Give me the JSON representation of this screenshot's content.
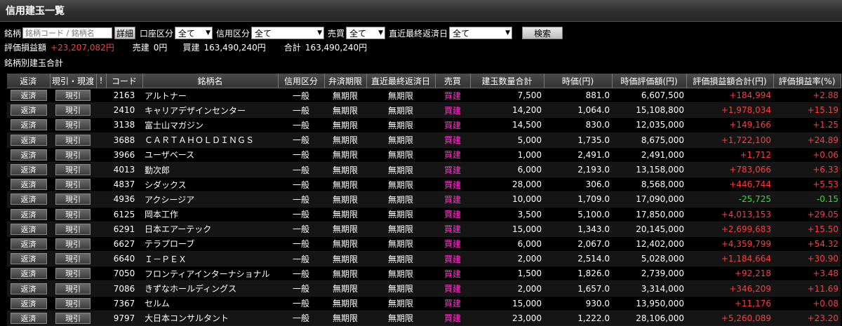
{
  "title": "信用建玉一覧",
  "filters": {
    "meigara_label": "銘柄",
    "meigara_placeholder": "銘柄コード / 銘柄名",
    "detail_button": "詳細",
    "kouza_label": "口座区分",
    "kouza_value": "全て",
    "shinyou_label": "信用区分",
    "shinyou_value": "全て",
    "baibai_label": "売買",
    "baibai_value": "全て",
    "hensai_label": "直近最終返済日",
    "hensai_value": "全て",
    "search_button": "検索"
  },
  "summary": {
    "hyouka_label": "評価損益額",
    "hyouka_value": "+23,207,082円",
    "uri_label": "売建",
    "uri_value": "0円",
    "kai_label": "買建",
    "kai_value": "163,490,240円",
    "total_label": "合計",
    "total_value": "163,490,240円"
  },
  "subheading": "銘柄別建玉合計",
  "columns": [
    "返済",
    "現引・現渡",
    "!",
    "コード",
    "銘柄名",
    "信用区分",
    "弁済期限",
    "直近最終返済日",
    "売買",
    "建玉数量合計",
    "時価(円)",
    "時価評価額(円)",
    "評価損益額合計(円)",
    "評価損益率(%)"
  ],
  "row_buttons": {
    "hensai": "返済",
    "genbiki": "現引"
  },
  "rows": [
    {
      "code": "2163",
      "name": "アルトナー",
      "kubun": "一般",
      "kigen": "無期限",
      "saishu": "無期限",
      "baibai": "買建",
      "qty": "7,500",
      "price": "881.0",
      "value": "6,607,500",
      "pl": "+184,994",
      "rate": "+2.88"
    },
    {
      "code": "2410",
      "name": "キャリアデザインセンター",
      "kubun": "一般",
      "kigen": "無期限",
      "saishu": "無期限",
      "baibai": "買建",
      "qty": "14,200",
      "price": "1,064.0",
      "value": "15,108,800",
      "pl": "+1,978,034",
      "rate": "+15.19"
    },
    {
      "code": "3138",
      "name": "富士山マガジン",
      "kubun": "一般",
      "kigen": "無期限",
      "saishu": "無期限",
      "baibai": "買建",
      "qty": "14,500",
      "price": "830.0",
      "value": "12,035,000",
      "pl": "+149,166",
      "rate": "+1.25"
    },
    {
      "code": "3688",
      "name": "ＣＡＲＴＡＨＯＬＤＩＮＧＳ",
      "kubun": "一般",
      "kigen": "無期限",
      "saishu": "無期限",
      "baibai": "買建",
      "qty": "5,000",
      "price": "1,735.0",
      "value": "8,675,000",
      "pl": "+1,722,100",
      "rate": "+24.89"
    },
    {
      "code": "3966",
      "name": "ユーザベース",
      "kubun": "一般",
      "kigen": "無期限",
      "saishu": "無期限",
      "baibai": "買建",
      "qty": "1,000",
      "price": "2,491.0",
      "value": "2,491,000",
      "pl": "+1,712",
      "rate": "+0.06"
    },
    {
      "code": "4013",
      "name": "勤次郎",
      "kubun": "一般",
      "kigen": "無期限",
      "saishu": "無期限",
      "baibai": "買建",
      "qty": "6,000",
      "price": "2,193.0",
      "value": "13,158,000",
      "pl": "+783,066",
      "rate": "+6.33"
    },
    {
      "code": "4837",
      "name": "シダックス",
      "kubun": "一般",
      "kigen": "無期限",
      "saishu": "無期限",
      "baibai": "買建",
      "qty": "28,000",
      "price": "306.0",
      "value": "8,568,000",
      "pl": "+446,744",
      "rate": "+5.53"
    },
    {
      "code": "4936",
      "name": "アクシージア",
      "kubun": "一般",
      "kigen": "無期限",
      "saishu": "無期限",
      "baibai": "買建",
      "qty": "10,000",
      "price": "1,709.0",
      "value": "17,090,000",
      "pl": "-25,725",
      "rate": "-0.15"
    },
    {
      "code": "6125",
      "name": "岡本工作",
      "kubun": "一般",
      "kigen": "無期限",
      "saishu": "無期限",
      "baibai": "買建",
      "qty": "3,500",
      "price": "5,100.0",
      "value": "17,850,000",
      "pl": "+4,013,153",
      "rate": "+29.05"
    },
    {
      "code": "6291",
      "name": "日本エアーテック",
      "kubun": "一般",
      "kigen": "無期限",
      "saishu": "無期限",
      "baibai": "買建",
      "qty": "15,000",
      "price": "1,343.0",
      "value": "20,145,000",
      "pl": "+2,699,683",
      "rate": "+15.50"
    },
    {
      "code": "6627",
      "name": "テラプローブ",
      "kubun": "一般",
      "kigen": "無期限",
      "saishu": "無期限",
      "baibai": "買建",
      "qty": "6,000",
      "price": "2,067.0",
      "value": "12,402,000",
      "pl": "+4,359,799",
      "rate": "+54.32"
    },
    {
      "code": "6640",
      "name": "Ｉ－ＰＥＸ",
      "kubun": "一般",
      "kigen": "無期限",
      "saishu": "無期限",
      "baibai": "買建",
      "qty": "2,000",
      "price": "2,514.0",
      "value": "5,028,000",
      "pl": "+1,184,664",
      "rate": "+30.90"
    },
    {
      "code": "7050",
      "name": "フロンティアインターナショナル",
      "kubun": "一般",
      "kigen": "無期限",
      "saishu": "無期限",
      "baibai": "買建",
      "qty": "1,500",
      "price": "1,826.0",
      "value": "2,739,000",
      "pl": "+92,218",
      "rate": "+3.48"
    },
    {
      "code": "7086",
      "name": "きずなホールディングス",
      "kubun": "一般",
      "kigen": "無期限",
      "saishu": "無期限",
      "baibai": "買建",
      "qty": "2,000",
      "price": "1,657.0",
      "value": "3,314,000",
      "pl": "+346,209",
      "rate": "+11.69"
    },
    {
      "code": "7367",
      "name": "セルム",
      "kubun": "一般",
      "kigen": "無期限",
      "saishu": "無期限",
      "baibai": "買建",
      "qty": "15,000",
      "price": "930.0",
      "value": "13,950,000",
      "pl": "+11,176",
      "rate": "+0.08"
    },
    {
      "code": "9797",
      "name": "大日本コンサルタント",
      "kubun": "一般",
      "kigen": "無期限",
      "saishu": "無期限",
      "baibai": "買建",
      "qty": "23,000",
      "price": "1,222.0",
      "value": "28,106,000",
      "pl": "+5,260,089",
      "rate": "+23.20"
    }
  ]
}
